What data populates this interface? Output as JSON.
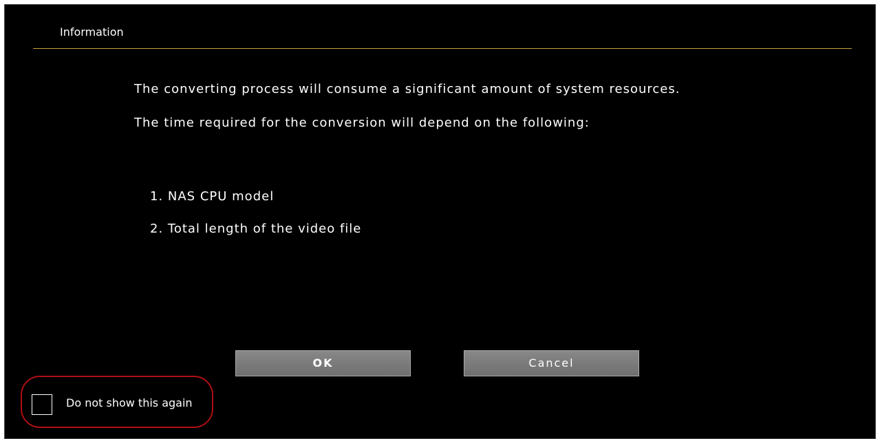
{
  "dialog": {
    "title": "Information",
    "message": [
      "The converting process will consume a significant amount of system resources.",
      "The time required for the conversion will depend on the following:"
    ],
    "list": [
      "1. NAS CPU model",
      "2. Total length of the video file"
    ],
    "ok_label": "OK",
    "cancel_label": "Cancel",
    "dont_show_label": "Do not show this again",
    "dont_show_checked": false
  },
  "colors": {
    "background": "#000000",
    "text": "#ffffff",
    "title_rule": "#c9a13c",
    "button": "#7a7a7a",
    "highlight_circle": "#b10f14"
  }
}
